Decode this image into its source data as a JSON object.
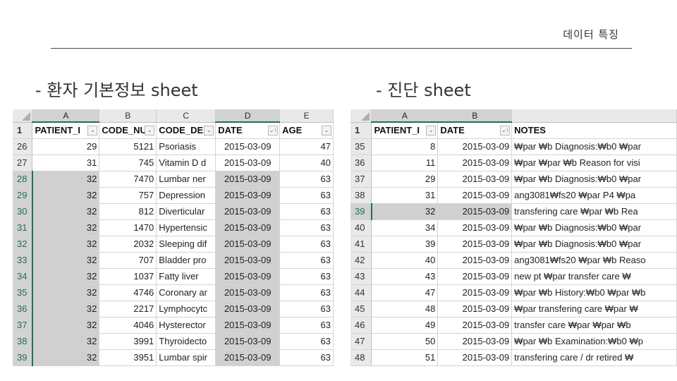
{
  "slide": {
    "title": "데이터 특징"
  },
  "left": {
    "label": "- 환자 기본정보 sheet",
    "columns": [
      "A",
      "B",
      "C",
      "D",
      "E"
    ],
    "header": [
      "PATIENT_I",
      "CODE_NU",
      "CODE_DE",
      "DATE",
      "AGE"
    ],
    "header_filters": [
      "⌄",
      "⌄",
      "⌄",
      "⌄↑",
      "⌄"
    ],
    "rows": [
      {
        "rn": "26",
        "pid": "29",
        "code": "5121",
        "desc": "Psoriasis",
        "date": "2015-03-09",
        "age": "47"
      },
      {
        "rn": "27",
        "pid": "31",
        "code": "745",
        "desc": "Vitamin D d",
        "date": "2015-03-09",
        "age": "40"
      },
      {
        "rn": "28",
        "pid": "32",
        "code": "7470",
        "desc": "Lumbar ner",
        "date": "2015-03-09",
        "age": "63"
      },
      {
        "rn": "29",
        "pid": "32",
        "code": "757",
        "desc": "Depression",
        "date": "2015-03-09",
        "age": "63"
      },
      {
        "rn": "30",
        "pid": "32",
        "code": "812",
        "desc": "Diverticular",
        "date": "2015-03-09",
        "age": "63"
      },
      {
        "rn": "31",
        "pid": "32",
        "code": "1470",
        "desc": "Hypertensic",
        "date": "2015-03-09",
        "age": "63"
      },
      {
        "rn": "32",
        "pid": "32",
        "code": "2032",
        "desc": "Sleeping dif",
        "date": "2015-03-09",
        "age": "63"
      },
      {
        "rn": "33",
        "pid": "32",
        "code": "707",
        "desc": "Bladder pro",
        "date": "2015-03-09",
        "age": "63"
      },
      {
        "rn": "34",
        "pid": "32",
        "code": "1037",
        "desc": "Fatty liver",
        "date": "2015-03-09",
        "age": "63"
      },
      {
        "rn": "35",
        "pid": "32",
        "code": "4746",
        "desc": "Coronary ar",
        "date": "2015-03-09",
        "age": "63"
      },
      {
        "rn": "36",
        "pid": "32",
        "code": "2217",
        "desc": "Lymphocytc",
        "date": "2015-03-09",
        "age": "63"
      },
      {
        "rn": "37",
        "pid": "32",
        "code": "4046",
        "desc": "Hysterector",
        "date": "2015-03-09",
        "age": "63"
      },
      {
        "rn": "38",
        "pid": "32",
        "code": "3991",
        "desc": "Thyroidecto",
        "date": "2015-03-09",
        "age": "63"
      },
      {
        "rn": "39",
        "pid": "32",
        "code": "3951",
        "desc": "Lumbar spir",
        "date": "2015-03-09",
        "age": "63"
      }
    ]
  },
  "right": {
    "label": "- 진단 sheet",
    "columns": [
      "A",
      "B",
      ""
    ],
    "header": [
      "PATIENT_I",
      "DATE",
      "NOTES"
    ],
    "header_filters": [
      "⌄",
      "⌄↑"
    ],
    "rows": [
      {
        "rn": "35",
        "pid": "8",
        "date": "2015-03-09",
        "notes": "₩par ₩b Diagnosis:₩b0   ₩par"
      },
      {
        "rn": "36",
        "pid": "11",
        "date": "2015-03-09",
        "notes": "₩par   ₩par ₩b Reason for visi"
      },
      {
        "rn": "37",
        "pid": "29",
        "date": "2015-03-09",
        "notes": "₩par ₩b Diagnosis:₩b0   ₩par"
      },
      {
        "rn": "38",
        "pid": "31",
        "date": "2015-03-09",
        "notes": "ang3081₩fs20   ₩par P4   ₩pa"
      },
      {
        "rn": "39",
        "pid": "32",
        "date": "2015-03-09",
        "notes": "transfering care   ₩par ₩b Rea"
      },
      {
        "rn": "40",
        "pid": "34",
        "date": "2015-03-09",
        "notes": "₩par ₩b Diagnosis:₩b0   ₩par"
      },
      {
        "rn": "41",
        "pid": "39",
        "date": "2015-03-09",
        "notes": "₩par ₩b Diagnosis:₩b0   ₩par"
      },
      {
        "rn": "42",
        "pid": "40",
        "date": "2015-03-09",
        "notes": "ang3081₩fs20   ₩par ₩b Reaso"
      },
      {
        "rn": "43",
        "pid": "43",
        "date": "2015-03-09",
        "notes": "new pt   ₩par transfer care   ₩"
      },
      {
        "rn": "44",
        "pid": "47",
        "date": "2015-03-09",
        "notes": "₩par ₩b History:₩b0   ₩par ₩b"
      },
      {
        "rn": "45",
        "pid": "48",
        "date": "2015-03-09",
        "notes": "₩par transfering care   ₩par   ₩"
      },
      {
        "rn": "46",
        "pid": "49",
        "date": "2015-03-09",
        "notes": "transfer care   ₩par   ₩par ₩b"
      },
      {
        "rn": "47",
        "pid": "50",
        "date": "2015-03-09",
        "notes": "₩par ₩b Examination:₩b0   ₩p"
      },
      {
        "rn": "48",
        "pid": "51",
        "date": "2015-03-09",
        "notes": "transfering care / dr retired   ₩"
      }
    ]
  }
}
